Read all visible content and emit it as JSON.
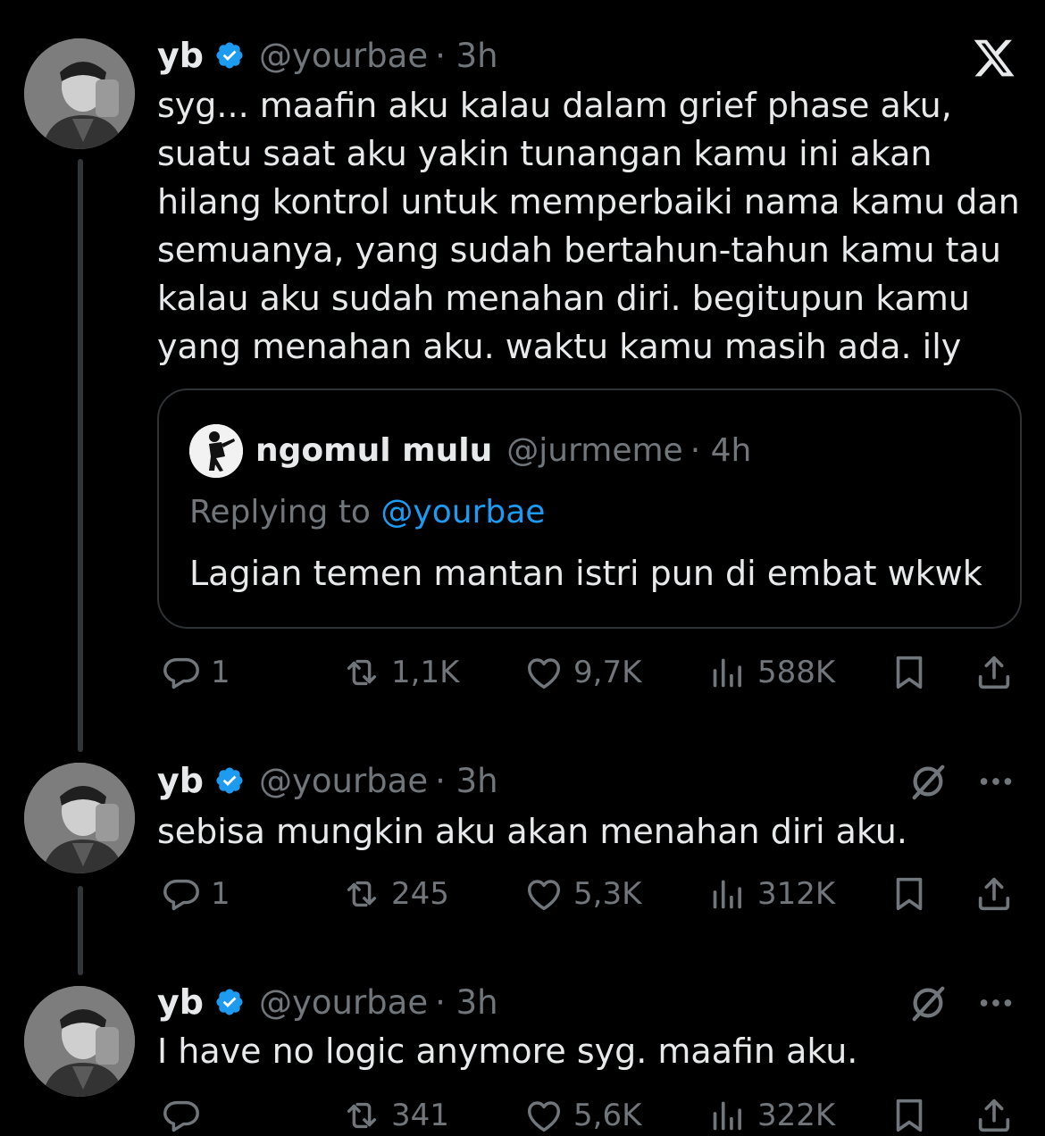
{
  "tweets": [
    {
      "name": "yb",
      "handle": "@yourbae",
      "time": "· 3h",
      "text": "syg... maafin aku kalau dalam grief phase aku,\nsuatu saat aku yakin tunangan kamu ini akan\nhilang kontrol untuk memperbaiki nama kamu dan\nsemuanya, yang sudah bertahun-tahun kamu tau\nkalau aku sudah menahan diri. begitupun kamu\nyang menahan aku. waktu kamu masih ada. ily",
      "stats": {
        "replies": "1",
        "reposts": "1,1K",
        "likes": "9,7K",
        "views": "588K"
      }
    },
    {
      "name": "yb",
      "handle": "@yourbae",
      "time": "· 3h",
      "text": "sebisa mungkin aku akan menahan diri aku.",
      "stats": {
        "replies": "1",
        "reposts": "245",
        "likes": "5,3K",
        "views": "312K"
      }
    },
    {
      "name": "yb",
      "handle": "@yourbae",
      "time": "· 3h",
      "text": "I have no logic anymore syg. maafin aku.",
      "stats": {
        "replies": "",
        "reposts": "341",
        "likes": "5,6K",
        "views": "322K"
      }
    }
  ],
  "quote": {
    "name": "ngomul mulu",
    "handle": "@jurmeme",
    "time": "· 4h",
    "replying_prefix": "Replying to ",
    "replying_mention": "@yourbae",
    "text": "Lagian temen mantan istri pun di embat wkwk"
  },
  "colors": {
    "background": "#000000",
    "text": "#e7e9ea",
    "muted": "#71767b",
    "accent": "#1d9bf0",
    "border": "#2f3336"
  },
  "icons": [
    "x-logo-icon",
    "verified-badge-icon",
    "reply-icon",
    "repost-icon",
    "like-icon",
    "views-icon",
    "bookmark-icon",
    "share-icon",
    "grok-icon",
    "more-icon"
  ]
}
